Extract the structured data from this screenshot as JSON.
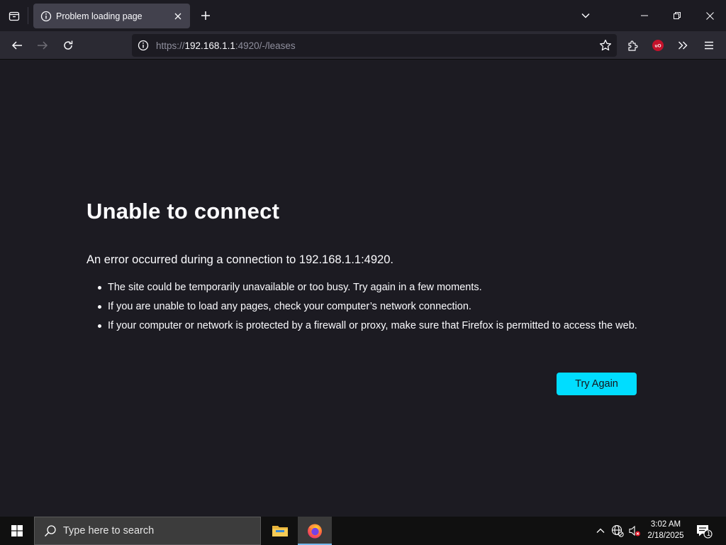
{
  "browser": {
    "tab": {
      "title": "Problem loading page"
    },
    "url": {
      "scheme": "https://",
      "host": "192.168.1.1",
      "rest": ":4920/-/leases"
    }
  },
  "error_page": {
    "title": "Unable to connect",
    "description": "An error occurred during a connection to 192.168.1.1:4920.",
    "bullets": [
      "The site could be temporarily unavailable or too busy. Try again in a few moments.",
      "If you are unable to load any pages, check your computer’s network connection.",
      "If your computer or network is protected by a firewall or proxy, make sure that Firefox is permitted to access the web."
    ],
    "try_again_label": "Try Again"
  },
  "taskbar": {
    "search_placeholder": "Type here to search",
    "time": "3:02 AM",
    "date": "2/18/2025",
    "notification_count": "1"
  },
  "colors": {
    "accent": "#00ddff",
    "background": "#1c1b22",
    "toolbar": "#2b2a33",
    "ublock": "#c4122b"
  }
}
